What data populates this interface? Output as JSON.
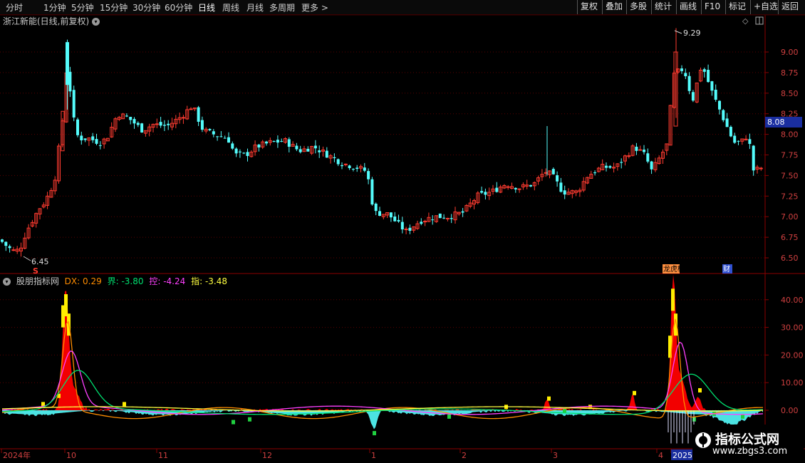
{
  "toolbar": {
    "periods": [
      "分时",
      "1分钟",
      "5分钟",
      "15分钟",
      "30分钟",
      "60分钟",
      "日线",
      "周线",
      "月线",
      "多周期",
      "更多 >"
    ],
    "active_period": "日线",
    "right_buttons": [
      "复权",
      "叠加",
      "多股",
      "统计",
      "画线",
      "F10",
      "标记",
      "+自选",
      "返回"
    ]
  },
  "main_chart": {
    "title": "浙江新能(日线,前复权)",
    "price_ticks": [
      "9.00",
      "8.75",
      "8.50",
      "8.25",
      "8.00",
      "7.75",
      "7.50",
      "7.25",
      "7.00",
      "6.75",
      "6.50"
    ],
    "current_price": "8.08",
    "high_label": "9.29",
    "low_label": "6.45",
    "event_markers": [
      "龙虎榜",
      "财"
    ],
    "signal_mark": "S"
  },
  "indicator": {
    "name": "股朋指标网",
    "dx_label": "DX:",
    "dx_value": "0.29",
    "jie_label": "界:",
    "jie_value": "-3.80",
    "kong_label": "控:",
    "kong_value": "-4.24",
    "zhi_label": "指:",
    "zhi_value": "-3.48",
    "ticks": [
      "40.00",
      "30.00",
      "20.00",
      "10.00",
      "0.00"
    ]
  },
  "time_axis": [
    "2024年",
    "10",
    "11",
    "12",
    "1",
    "2",
    "3",
    "4",
    "2025年"
  ],
  "watermark": {
    "title": "指标公式网",
    "url": "www.zbgs3.com"
  },
  "colors": {
    "up": "#ff3b30",
    "down": "#54fcfc",
    "dx": "#ff8c00",
    "jie": "#00e070",
    "kong": "#ff40ff",
    "zhi": "#ffff40",
    "axis": "#8b0000"
  },
  "chart_data": {
    "type": "candlestick",
    "y_range": [
      6.4,
      9.35
    ],
    "price_bars": "~200 daily candles, Sep 2024 to Apr 2025",
    "high": 9.29,
    "low": 6.45,
    "last": 8.08
  }
}
